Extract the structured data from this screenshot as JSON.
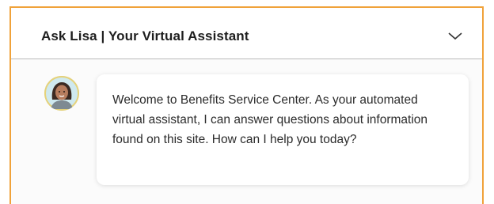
{
  "header": {
    "title": "Ask Lisa | Your Virtual Assistant",
    "collapse_icon": "chevron-down-icon"
  },
  "assistant": {
    "avatar_icon": "assistant-avatar",
    "message": "Welcome to Benefits Service Center. As your automated virtual assistant, I can answer questions about information found on this site. How can I help you today?"
  },
  "colors": {
    "frame_border": "#f0a23a",
    "header_divider": "#b9b9b9",
    "avatar_ring": "#e2cf73"
  }
}
